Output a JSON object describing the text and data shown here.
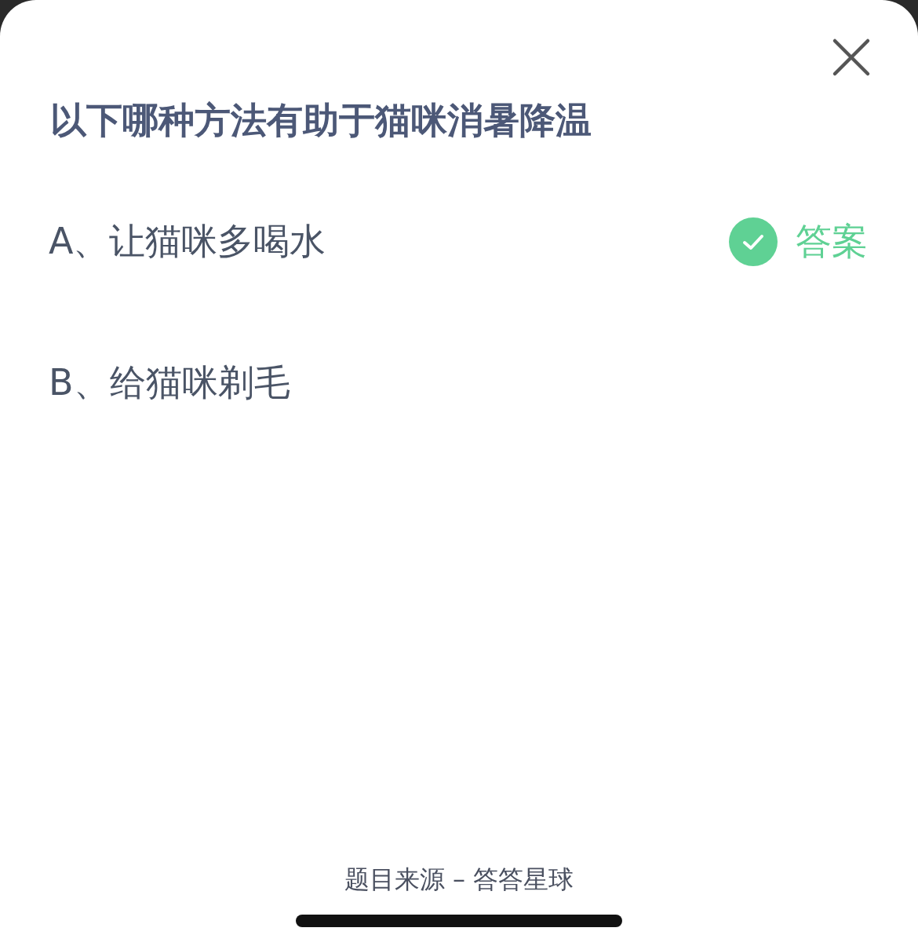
{
  "question": "以下哪种方法有助于猫咪消暑降温",
  "options": [
    {
      "text": "A、让猫咪多喝水",
      "correct": true
    },
    {
      "text": "B、给猫咪剃毛",
      "correct": false
    }
  ],
  "answer_badge": "答案",
  "source": "题目来源 – 答答星球"
}
